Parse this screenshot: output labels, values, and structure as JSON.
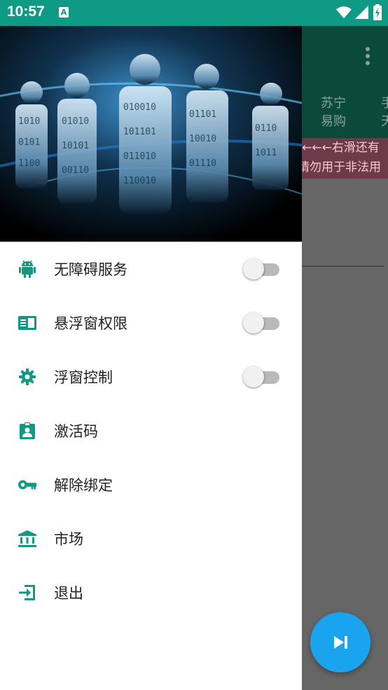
{
  "status_bar": {
    "time": "10:57",
    "notification_icon": "a-icon",
    "icons": [
      "wifi-icon",
      "signal-icon",
      "battery-charging-icon"
    ]
  },
  "background_app": {
    "tab_label_line1": "苏宁",
    "tab_label_line2": "易购",
    "tab_partial_1": "手",
    "tab_partial_2": "天",
    "banner_line1": "←←←右滑还有",
    "banner_line2": "请勿用于非法用"
  },
  "drawer": {
    "header_image": "digital-people-banner",
    "items": [
      {
        "label": "无障碍服务",
        "icon": "android-icon",
        "has_toggle": true,
        "toggle_on": false
      },
      {
        "label": "悬浮窗权限",
        "icon": "window-icon",
        "has_toggle": true,
        "toggle_on": false
      },
      {
        "label": "浮窗控制",
        "icon": "gear-icon",
        "has_toggle": true,
        "toggle_on": false
      },
      {
        "label": "激活码",
        "icon": "badge-icon",
        "has_toggle": false
      },
      {
        "label": "解除绑定",
        "icon": "key-icon",
        "has_toggle": false
      },
      {
        "label": "市场",
        "icon": "bank-icon",
        "has_toggle": false
      },
      {
        "label": "退出",
        "icon": "exit-icon",
        "has_toggle": false
      }
    ]
  },
  "fab": {
    "icon": "skip-next-icon"
  },
  "colors": {
    "status_bar": "#0f9a86",
    "icon_tint": "#0f9a86",
    "fab": "#1aa3ef",
    "toolbar_dim": "#0b4a3b"
  }
}
